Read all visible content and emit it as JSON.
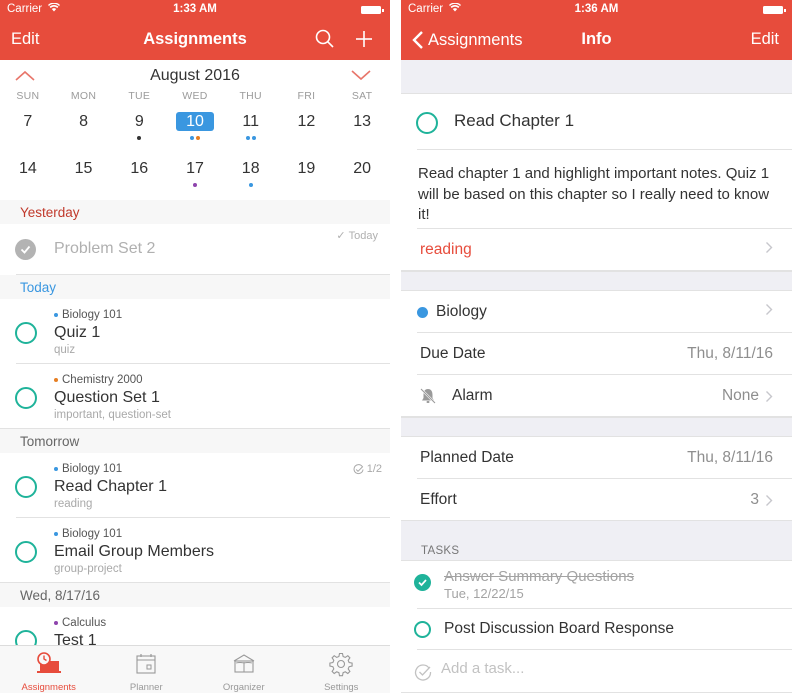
{
  "left": {
    "status": {
      "carrier": "Carrier",
      "time": "1:33 AM"
    },
    "nav": {
      "left": "Edit",
      "title": "Assignments",
      "search_icon": "search-icon",
      "add_icon": "plus-icon"
    },
    "calendar": {
      "month": "August 2016",
      "weekdays": [
        "SUN",
        "MON",
        "TUE",
        "WED",
        "THU",
        "FRI",
        "SAT"
      ],
      "weeks": [
        [
          {
            "day": "7",
            "dots": []
          },
          {
            "day": "8",
            "dots": []
          },
          {
            "day": "9",
            "dots": [
              "#333333"
            ]
          },
          {
            "day": "10",
            "dots": [
              "#3a97e0",
              "#e67e22"
            ],
            "selected": true
          },
          {
            "day": "11",
            "dots": [
              "#3a97e0",
              "#3a97e0"
            ]
          },
          {
            "day": "12",
            "dots": []
          },
          {
            "day": "13",
            "dots": []
          }
        ],
        [
          {
            "day": "14",
            "dots": []
          },
          {
            "day": "15",
            "dots": []
          },
          {
            "day": "16",
            "dots": []
          },
          {
            "day": "17",
            "dots": [
              "#8e44ad"
            ]
          },
          {
            "day": "18",
            "dots": [
              "#3a97e0"
            ]
          },
          {
            "day": "19",
            "dots": []
          },
          {
            "day": "20",
            "dots": []
          }
        ]
      ]
    },
    "sections": {
      "yesterday": "Yesterday",
      "today": "Today",
      "tomorrow": "Tomorrow",
      "wed": "Wed, 8/17/16"
    },
    "completed": {
      "title": "Problem Set 2",
      "meta": "Today"
    },
    "assignments": [
      {
        "course": "Biology 101",
        "course_color": "#3a97e0",
        "title": "Quiz 1",
        "tags": "quiz",
        "meta": ""
      },
      {
        "course": "Chemistry 2000",
        "course_color": "#e67e22",
        "title": "Question Set 1",
        "tags": "important, question-set",
        "meta": ""
      },
      {
        "course": "Biology 101",
        "course_color": "#3a97e0",
        "title": "Read Chapter 1",
        "tags": "reading",
        "meta": "1/2"
      },
      {
        "course": "Biology 101",
        "course_color": "#3a97e0",
        "title": "Email Group Members",
        "tags": "group-project",
        "meta": ""
      },
      {
        "course": "Calculus",
        "course_color": "#8e44ad",
        "title": "Test 1",
        "tags": "",
        "meta": ""
      }
    ],
    "tabs": [
      {
        "label": "Assignments",
        "icon": "assignments-icon",
        "active": true
      },
      {
        "label": "Planner",
        "icon": "calendar-icon",
        "active": false
      },
      {
        "label": "Organizer",
        "icon": "book-icon",
        "active": false
      },
      {
        "label": "Settings",
        "icon": "gear-icon",
        "active": false
      }
    ]
  },
  "right": {
    "status": {
      "carrier": "Carrier",
      "time": "1:36 AM"
    },
    "nav": {
      "back": "Assignments",
      "title": "Info",
      "right": "Edit"
    },
    "title": "Read Chapter 1",
    "notes": "Read chapter 1 and highlight important notes. Quiz 1 will be based on this chapter so I really need to know it!",
    "tag": "reading",
    "course": {
      "name": "Biology",
      "color": "#3a97e0"
    },
    "due_date": {
      "label": "Due Date",
      "value": "Thu, 8/11/16"
    },
    "alarm": {
      "label": "Alarm",
      "value": "None"
    },
    "planned_date": {
      "label": "Planned Date",
      "value": "Thu, 8/11/16"
    },
    "effort": {
      "label": "Effort",
      "value": "3"
    },
    "tasks_header": "TASKS",
    "tasks": [
      {
        "title": "Answer Summary Questions",
        "date": "Tue, 12/22/15",
        "done": true
      },
      {
        "title": "Post Discussion Board Response",
        "done": false
      }
    ],
    "add_task_placeholder": "Add a task..."
  },
  "colors": {
    "accent": "#e74c3c",
    "selected_day": "#3a97e0",
    "check": "#1fb39a"
  }
}
